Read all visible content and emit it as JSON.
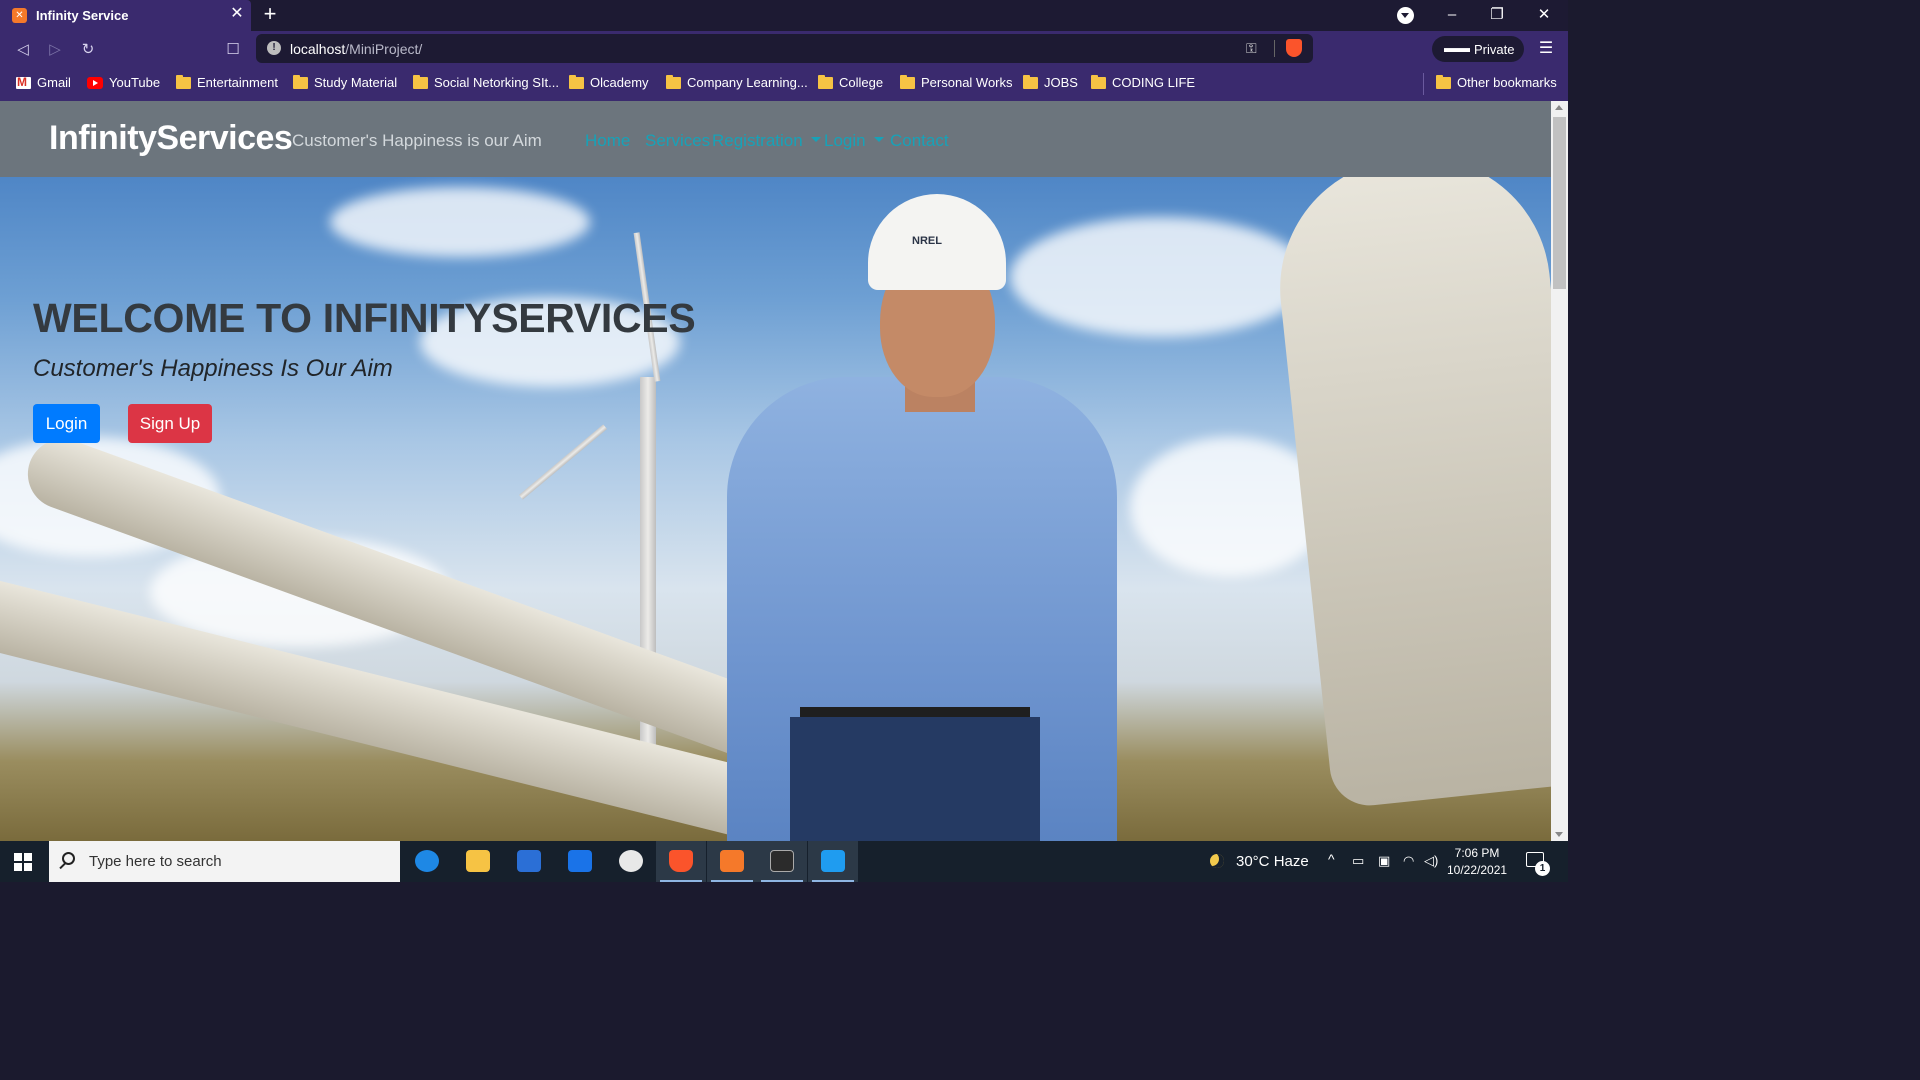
{
  "browser": {
    "tab": {
      "title": "Infinity Service",
      "favicon_glyph": "✕",
      "close_glyph": "✕"
    },
    "new_tab_glyph": "+",
    "window_controls": {
      "minimize": "–",
      "maximize": "❐",
      "close": "✕"
    },
    "nav": {
      "back": "◁",
      "forward": "▷",
      "reload": "↻",
      "bookmark": "☐"
    },
    "address": {
      "host": "localhost",
      "path": "/MiniProject/",
      "info_glyph": "!",
      "key_glyph": "⚿"
    },
    "private_label": "Private",
    "private_glyph": "▬▬",
    "menu_glyph": "☰",
    "bookmarks": [
      {
        "label": "Gmail",
        "icon": "gmail-icon"
      },
      {
        "label": "YouTube",
        "icon": "youtube-icon"
      },
      {
        "label": "Entertainment",
        "icon": "folder-icon"
      },
      {
        "label": "Study Material",
        "icon": "folder-icon"
      },
      {
        "label": "Social Netorking SIt...",
        "icon": "folder-icon"
      },
      {
        "label": "Olcademy",
        "icon": "folder-icon"
      },
      {
        "label": "Company Learning...",
        "icon": "folder-icon"
      },
      {
        "label": "College",
        "icon": "folder-icon"
      },
      {
        "label": "Personal Works",
        "icon": "folder-icon"
      },
      {
        "label": "JOBS",
        "icon": "folder-icon"
      },
      {
        "label": "CODING LIFE",
        "icon": "folder-icon"
      }
    ],
    "other_bookmarks": "Other bookmarks"
  },
  "site": {
    "brand": "InfinityServices",
    "tagline": "Customer's Happiness is our Aim",
    "nav": {
      "home": "Home",
      "services": "Services",
      "registration": "Registration",
      "login": "Login",
      "contact": "Contact"
    },
    "hero": {
      "title": "WELCOME TO INFINITYSERVICES",
      "subtitle": "Customer's Happiness Is Our Aim",
      "login_button": "Login",
      "signup_button": "Sign Up",
      "hat_logo": "NREL"
    }
  },
  "taskbar": {
    "search_placeholder": "Type here to search",
    "weather": {
      "temp": "30°C",
      "condition": "Haze"
    },
    "tray": {
      "chevron": "^"
    },
    "time": "7:06 PM",
    "date": "10/22/2021",
    "notification_count": "1",
    "colors": {
      "edge": "#1e88e5",
      "explorer": "#f6c344",
      "store": "#2b6fd6",
      "mail": "#1a73e8",
      "brave": "#fb542b",
      "xampp": "#f5792a",
      "terminal": "#2b2b2b",
      "vscode": "#1f9cf0"
    }
  },
  "colors": {
    "tabbar": "#1d1a33",
    "toolbar": "#3a2a6e",
    "site_nav": "#6c757d",
    "nav_link": "#17a2b8",
    "login_btn": "#007bff",
    "signup_btn": "#dc3545"
  }
}
